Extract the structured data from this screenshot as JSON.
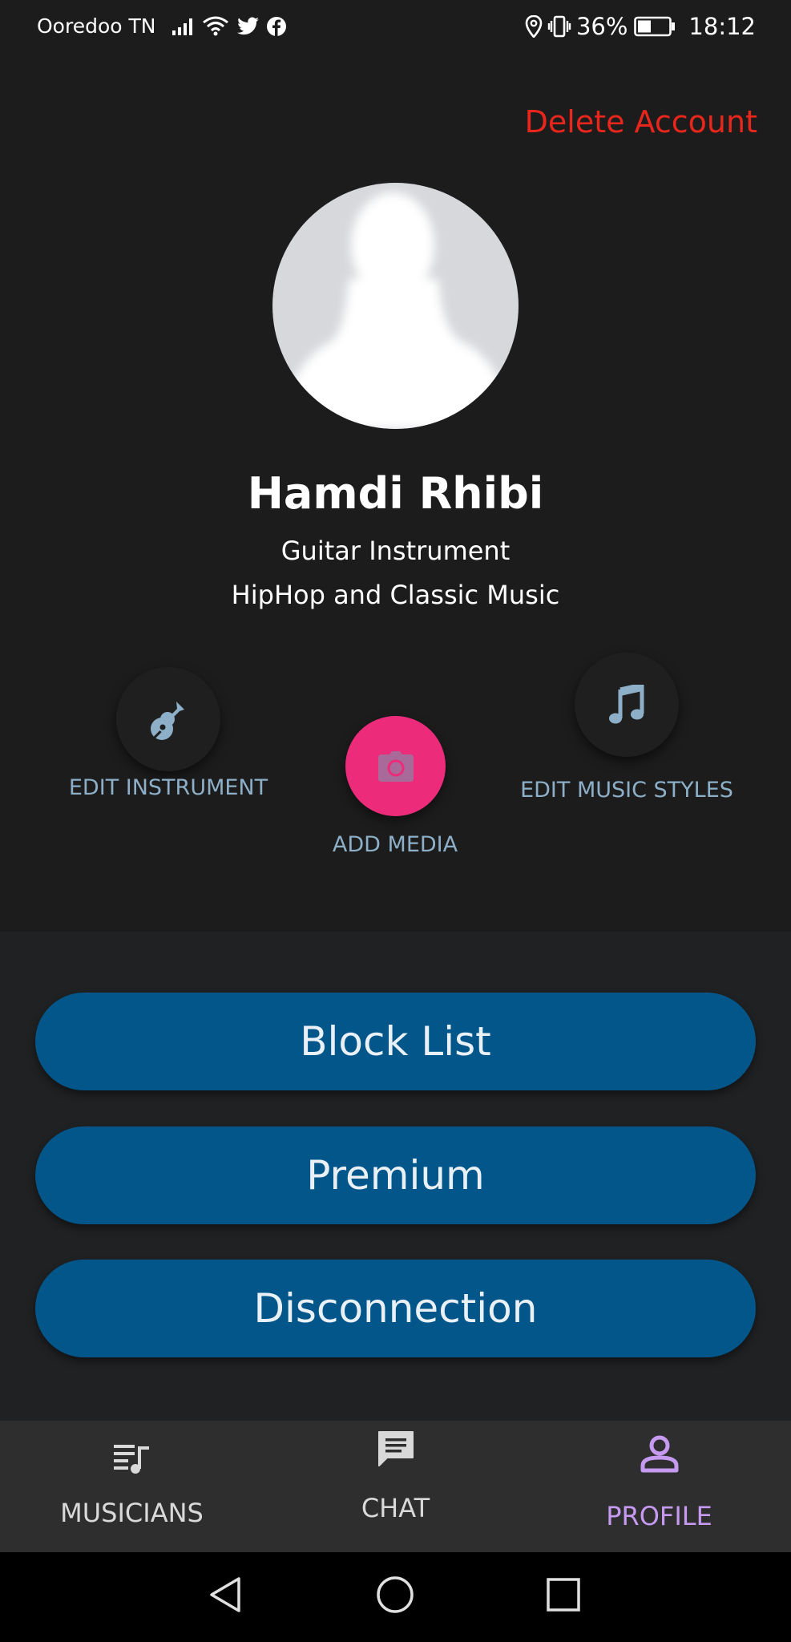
{
  "status_bar": {
    "carrier": "Ooredoo TN",
    "battery": "36%",
    "time": "18:12",
    "icons": [
      "signal-icon",
      "wifi-icon",
      "twitter-icon",
      "facebook-icon",
      "location-icon",
      "vibrate-icon",
      "battery-icon"
    ]
  },
  "header": {
    "delete_account_label": "Delete Account",
    "delete_color": "#e8261c"
  },
  "profile": {
    "name": "Hamdi Rhibi",
    "instrument": "Guitar Instrument",
    "music_styles": "HipHop and Classic Music",
    "avatar_icon": "default-user-silhouette"
  },
  "actions": {
    "edit_instrument": {
      "label": "EDIT INSTRUMENT",
      "icon": "guitar-icon"
    },
    "add_media": {
      "label": "ADD MEDIA",
      "icon": "camera-icon",
      "color": "#ec2b7a"
    },
    "edit_music_styles": {
      "label": "EDIT MUSIC STYLES",
      "icon": "music-note-icon"
    }
  },
  "buttons": {
    "block_list": "Block List",
    "premium": "Premium",
    "disconnection": "Disconnection",
    "color": "#02568a"
  },
  "bottom_nav": {
    "items": [
      {
        "label": "MUSICIANS",
        "icon": "playlist-music-icon",
        "active": false
      },
      {
        "label": "CHAT",
        "icon": "chat-icon",
        "active": false
      },
      {
        "label": "PROFILE",
        "icon": "person-icon",
        "active": true
      }
    ],
    "active_color": "#c79af2"
  },
  "system_nav": {
    "icons": [
      "back-icon",
      "home-icon",
      "recents-icon"
    ]
  }
}
